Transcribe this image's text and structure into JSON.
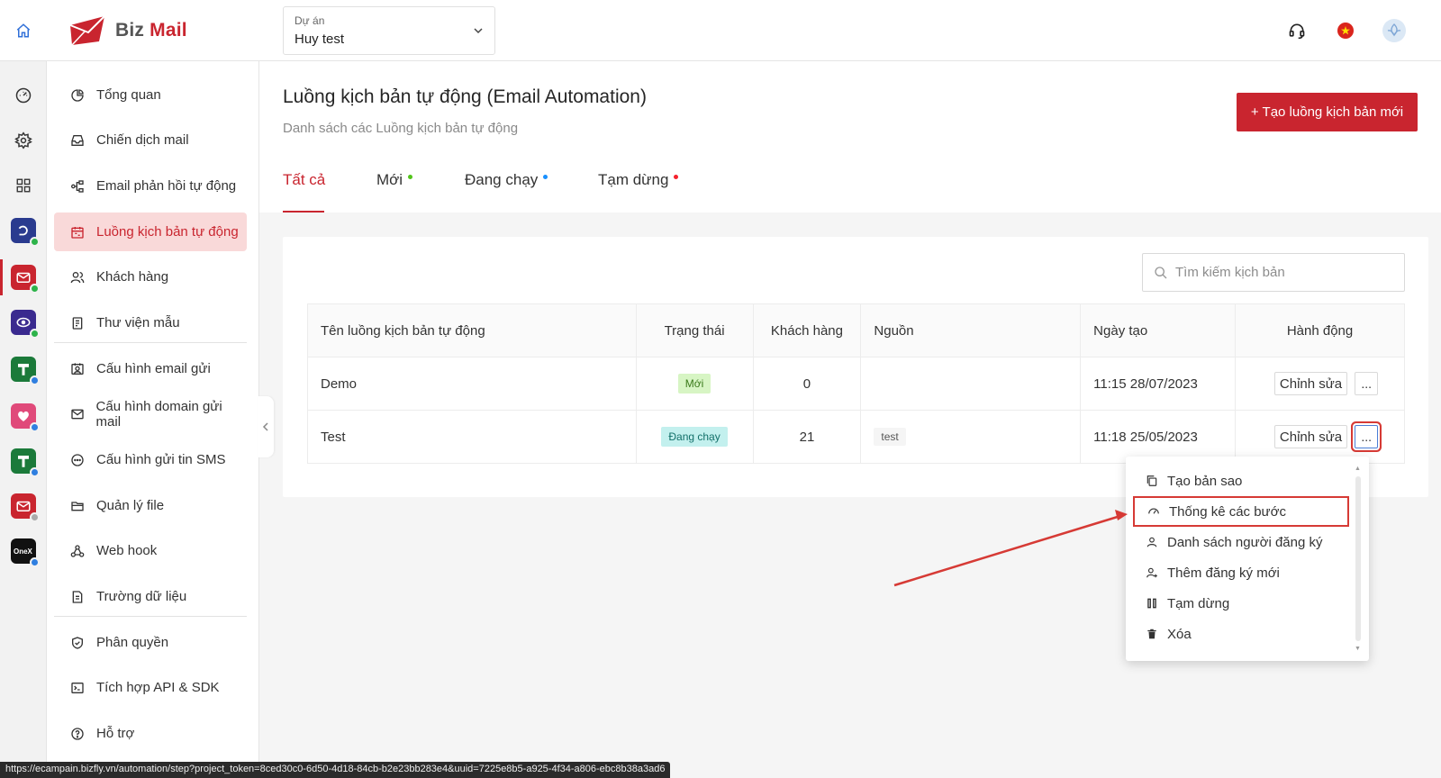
{
  "header": {
    "logo_text_part1": "Biz",
    "logo_text_part2": "Mail",
    "project_label": "Dự án",
    "project_value": "Huy test"
  },
  "rail": {
    "items": [
      {
        "name": "dashboard-icon"
      },
      {
        "name": "settings-icon"
      },
      {
        "name": "apps-grid-icon"
      },
      {
        "name": "app-bizfly-icon",
        "color": "#2a3b8f"
      },
      {
        "name": "app-bizmail-icon",
        "color": "#c9252f"
      },
      {
        "name": "app-chatbot-icon",
        "color": "#3a2a8f"
      },
      {
        "name": "app-green-1-icon",
        "color": "#1b7a3a"
      },
      {
        "name": "app-pink-icon",
        "color": "#e04a7a"
      },
      {
        "name": "app-green-2-icon",
        "color": "#1b7a3a"
      },
      {
        "name": "app-mail-2-icon",
        "color": "#c9252f"
      },
      {
        "name": "app-onex-icon",
        "color": "#111111"
      }
    ]
  },
  "sidebar": {
    "items": [
      {
        "label": "Tổng quan",
        "icon": "pie-chart-icon"
      },
      {
        "label": "Chiến dịch mail",
        "icon": "inbox-icon"
      },
      {
        "label": "Email phản hồi tự động",
        "icon": "flow-icon"
      },
      {
        "label": "Luồng kịch bản tự động",
        "icon": "calendar-flow-icon",
        "active": true
      },
      {
        "label": "Khách hàng",
        "icon": "users-icon"
      },
      {
        "label": "Thư viện mẫu",
        "icon": "template-icon"
      },
      {
        "label": "Cấu hình email gửi",
        "icon": "contact-card-icon"
      },
      {
        "label": "Cấu hình domain gửi mail",
        "icon": "mail-icon"
      },
      {
        "label": "Cấu hình gửi tin SMS",
        "icon": "sms-icon"
      },
      {
        "label": "Quản lý file",
        "icon": "folder-icon"
      },
      {
        "label": "Web hook",
        "icon": "webhook-icon"
      },
      {
        "label": "Trường dữ liệu",
        "icon": "document-icon"
      },
      {
        "label": "Phân quyền",
        "icon": "shield-icon"
      },
      {
        "label": "Tích hợp API & SDK",
        "icon": "terminal-icon"
      },
      {
        "label": "Hỗ trợ",
        "icon": "help-icon"
      }
    ]
  },
  "page": {
    "title": "Luồng kịch bản tự động (Email Automation)",
    "subtitle": "Danh sách các Luồng kịch bản tự động",
    "create_button": "+ Tạo luồng kịch bản mới",
    "tabs": [
      {
        "label": "Tất cả",
        "active": true,
        "dot": ""
      },
      {
        "label": "Mới",
        "dot": "#52c41a"
      },
      {
        "label": "Đang chạy",
        "dot": "#1890ff"
      },
      {
        "label": "Tạm dừng",
        "dot": "#f5222d"
      }
    ],
    "search_placeholder": "Tìm kiếm kịch bản"
  },
  "table": {
    "columns": [
      "Tên luồng kịch bản tự động",
      "Trạng thái",
      "Khách hàng",
      "Nguồn",
      "Ngày tạo",
      "Hành động"
    ],
    "rows": [
      {
        "name": "Demo",
        "status": "Mới",
        "status_type": "new",
        "customers": "0",
        "source": "",
        "created": "11:15 28/07/2023",
        "edit": "Chỉnh sửa",
        "more": "..."
      },
      {
        "name": "Test",
        "status": "Đang chạy",
        "status_type": "run",
        "customers": "21",
        "source": "test",
        "created": "11:18 25/05/2023",
        "edit": "Chỉnh sửa",
        "more": "..."
      }
    ]
  },
  "dropdown": {
    "items": [
      {
        "label": "Tạo bản sao",
        "icon": "copy-icon"
      },
      {
        "label": "Thống kê các bước",
        "icon": "gauge-icon",
        "highlighted": true
      },
      {
        "label": "Danh sách người đăng ký",
        "icon": "user-icon"
      },
      {
        "label": "Thêm đăng ký mới",
        "icon": "user-add-icon"
      },
      {
        "label": "Tạm dừng",
        "icon": "pause-icon"
      },
      {
        "label": "Xóa",
        "icon": "trash-icon"
      }
    ]
  },
  "statusbar": {
    "url": "https://ecampain.bizfly.vn/automation/step?project_token=8ced30c0-6d50-4d18-84cb-b2e23bb283e4&uuid=7225e8b5-a925-4f34-a806-ebc8b38a3ad6"
  },
  "colors": {
    "brand": "#c9252f",
    "annotation": "#d63a35"
  }
}
